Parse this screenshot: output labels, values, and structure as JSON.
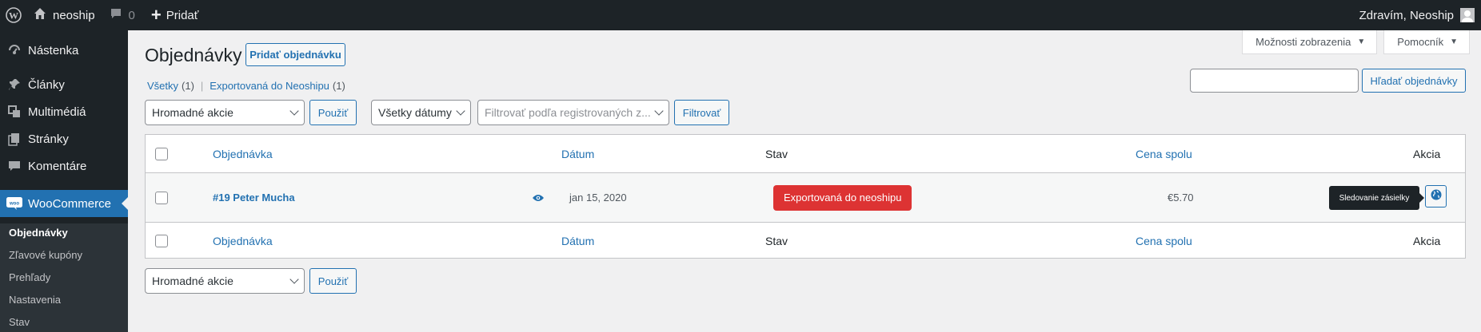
{
  "adminbar": {
    "wp_logo_icon": "wordpress-icon",
    "site_name": "neoship",
    "site_icon": "home-icon",
    "comments_icon": "comment-icon",
    "comments_count": "0",
    "new_label": "Pridať",
    "greeting": "Zdravím, Neoship"
  },
  "sidebar": {
    "items": [
      {
        "label": "Nástenka",
        "icon": "dashboard-icon"
      },
      {
        "label": "Články",
        "icon": "pin-icon"
      },
      {
        "label": "Multimédiá",
        "icon": "media-icon"
      },
      {
        "label": "Stránky",
        "icon": "pages-icon"
      },
      {
        "label": "Komentáre",
        "icon": "comment-icon"
      },
      {
        "label": "WooCommerce",
        "icon": "woo-icon"
      }
    ],
    "submenu": [
      "Objednávky",
      "Zľavové kupóny",
      "Prehľady",
      "Nastavenia",
      "Stav"
    ]
  },
  "screen_tabs": {
    "options": "Možnosti zobrazenia",
    "help": "Pomocník"
  },
  "page": {
    "title": "Objednávky",
    "add_button": "Pridať objednávku"
  },
  "views": {
    "all_label": "Všetky",
    "all_count": "(1)",
    "separator": "|",
    "exported_label": "Exportovaná do Neoshipu",
    "exported_count": "(1)"
  },
  "search": {
    "value": "",
    "button": "Hľadať objednávky"
  },
  "filters": {
    "bulk_actions": "Hromadné akcie",
    "apply": "Použiť",
    "dates": "Všetky dátumy",
    "customer_placeholder": "Filtrovať podľa registrovaných z...",
    "filter_button": "Filtrovať"
  },
  "table": {
    "columns": [
      "Objednávka",
      "Dátum",
      "Stav",
      "Cena spolu",
      "Akcia"
    ],
    "rows": [
      {
        "order": "#19 Peter Mucha",
        "date": "jan 15, 2020",
        "status": "Exportovaná do neoshipu",
        "total": "€5.70",
        "action_tooltip": "Sledovanie zásielky"
      }
    ]
  },
  "colors": {
    "accent": "#2271b1",
    "status_exported": "#dd3333",
    "adminbar": "#1d2327"
  }
}
